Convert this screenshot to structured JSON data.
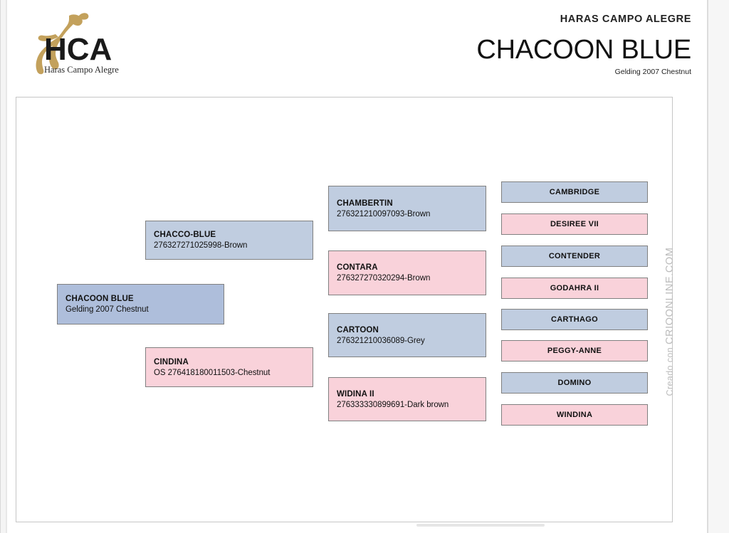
{
  "header": {
    "brand": "HARAS CAMPO ALEGRE",
    "horse_name": "CHACOON BLUE",
    "horse_subtitle": "Gelding 2007 Chestnut",
    "logo_text": "HCA",
    "logo_subtext": "Haras Campo Alegre"
  },
  "watermark": {
    "prefix": "Creado con",
    "site": "CRIOONLINE.COM"
  },
  "colors": {
    "male": "#c0cde0",
    "female": "#f9d2da",
    "subject": "#aebedb",
    "border": "#808080",
    "frame": "#c6c6c6",
    "logo_horse": "#c3a15c"
  },
  "pedigree": {
    "generation1": [
      {
        "name": "CHACOON BLUE",
        "details": "Gelding 2007 Chestnut",
        "sex": "subject"
      }
    ],
    "generation2": [
      {
        "name": "CHACCO-BLUE",
        "details": "276327271025998-Brown",
        "sex": "male"
      },
      {
        "name": "CINDINA",
        "details": "OS 276418180011503-Chestnut",
        "sex": "female"
      }
    ],
    "generation3": [
      {
        "name": "CHAMBERTIN",
        "details": "276321210097093-Brown",
        "sex": "male"
      },
      {
        "name": "CONTARA",
        "details": "276327270320294-Brown",
        "sex": "female"
      },
      {
        "name": "CARTOON",
        "details": "276321210036089-Grey",
        "sex": "male"
      },
      {
        "name": "WIDINA II",
        "details": "276333330899691-Dark brown",
        "sex": "female"
      }
    ],
    "generation4": [
      {
        "name": "CAMBRIDGE",
        "sex": "male"
      },
      {
        "name": "DESIREE VII",
        "sex": "female"
      },
      {
        "name": "CONTENDER",
        "sex": "male"
      },
      {
        "name": "GODAHRA II",
        "sex": "female"
      },
      {
        "name": "CARTHAGO",
        "sex": "male"
      },
      {
        "name": "PEGGY-ANNE",
        "sex": "female"
      },
      {
        "name": "DOMINO",
        "sex": "male"
      },
      {
        "name": "WINDINA",
        "sex": "female"
      }
    ]
  }
}
